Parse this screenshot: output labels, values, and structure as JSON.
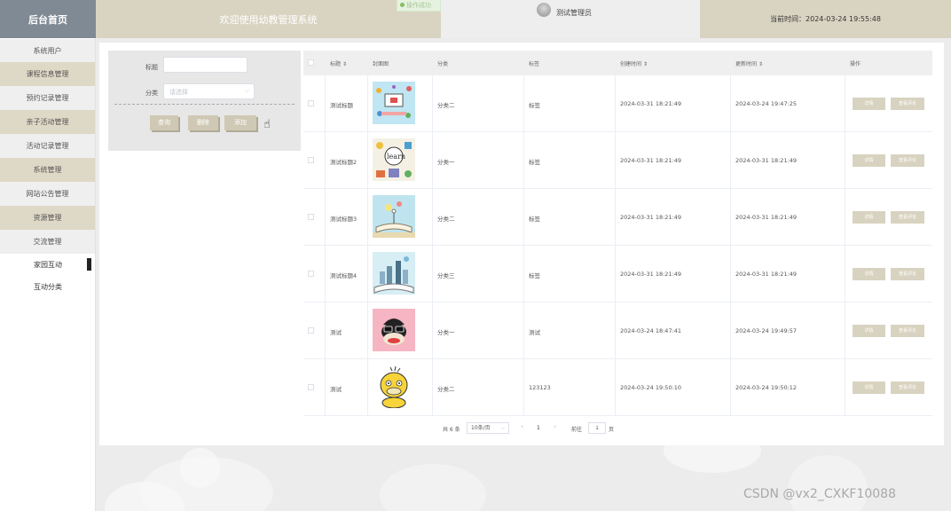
{
  "header": {
    "brand": "后台首页",
    "welcome": "欢迎使用幼教管理系统",
    "user_name": "测试管理员",
    "time_label": "当前时间：",
    "current_time": "2024-03-24 19:55:48",
    "toast": "操作成功"
  },
  "sidebar": {
    "items": [
      "系统用户",
      "课程信息管理",
      "预约记录管理",
      "亲子活动管理",
      "活动记录管理",
      "系统管理",
      "网站公告管理",
      "资源管理",
      "交流管理"
    ],
    "subitems": [
      "家园互动",
      "互动分类"
    ]
  },
  "search": {
    "title_label": "标题",
    "title_value": "",
    "category_label": "分类",
    "category_placeholder": "请选择",
    "query_button": "查询",
    "delete_button": "删除",
    "add_button": "添加"
  },
  "table": {
    "headers": {
      "title": "标题",
      "cover": "封面图",
      "category": "分类",
      "tag": "标签",
      "created": "创建时间",
      "updated": "更新时间",
      "actions": "操作"
    },
    "sort_glyph": "⇕",
    "detail_label": "详情",
    "comment_label": "查看评论",
    "rows": [
      {
        "title": "测试标题",
        "category": "分类二",
        "tag": "标签",
        "created": "2024-03-31 18:21:49",
        "updated": "2024-03-24 19:47:25",
        "image": "classroom-illustration"
      },
      {
        "title": "测试标题2",
        "category": "分类一",
        "tag": "标签",
        "created": "2024-03-31 18:21:49",
        "updated": "2024-03-31 18:21:49",
        "image": "learn-doodle"
      },
      {
        "title": "测试标题3",
        "category": "分类二",
        "tag": "标签",
        "created": "2024-03-31 18:21:49",
        "updated": "2024-03-31 18:21:49",
        "image": "open-book"
      },
      {
        "title": "测试标题4",
        "category": "分类三",
        "tag": "标签",
        "created": "2024-03-31 18:21:49",
        "updated": "2024-03-31 18:21:49",
        "image": "book-city"
      },
      {
        "title": "测试",
        "category": "分类一",
        "tag": "测试",
        "created": "2024-03-24 18:47:41",
        "updated": "2024-03-24 19:49:57",
        "image": "monkey-face"
      },
      {
        "title": "测试",
        "category": "分类二",
        "tag": "123123",
        "created": "2024-03-24 19:50:10",
        "updated": "2024-03-24 19:50:12",
        "image": "psyduck"
      }
    ]
  },
  "pagination": {
    "total": "共 6 条",
    "page_size": "10条/页",
    "current_page": "1",
    "goto_label": "前往",
    "goto_value": "1",
    "page_suffix": "页",
    "prev_glyph": "‹",
    "next_glyph": "›"
  },
  "watermark": "CSDN @vx2_CXKF10088",
  "colors": {
    "accent": "#d9d4c2",
    "button": "#cfc8b4",
    "brand_bg": "#7f8a94"
  }
}
